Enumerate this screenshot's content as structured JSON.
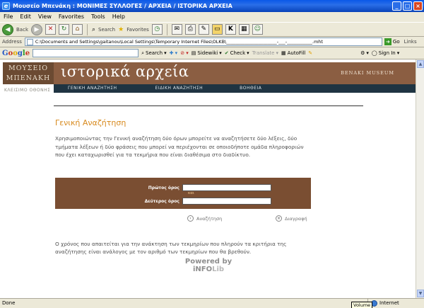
{
  "window": {
    "title": "Μουσείο Μπενάκη : ΜΟΝΙΜΕΣ ΣΥΛΛΟΓΕΣ / ΑΡΧΕΙΑ / ΙΣΤΟΡΙΚΑ ΑΡΧΕΙΑ",
    "minimize": "_",
    "maximize": "□",
    "close": "×"
  },
  "menu": [
    "File",
    "Edit",
    "View",
    "Favorites",
    "Tools",
    "Help"
  ],
  "toolbar": {
    "back": "Back",
    "search": "Search",
    "favorites": "Favorites"
  },
  "address": {
    "label": "Address",
    "url": "C:\\Documents and Settings\\gaitanou\\Local Settings\\Temporary Internet Files\\OLKB\\______________________-___-___________.mht",
    "go": "Go",
    "links": "Links"
  },
  "google": {
    "search": "Search",
    "sidewiki": "Sidewiki",
    "check": "Check",
    "translate": "Translate",
    "autofill": "AutoFill",
    "signin": "Sign In"
  },
  "page": {
    "logo_line1": "ΜΟΥΣΕΙΟ",
    "logo_line2": "ΜΠΕΝΑΚΗ",
    "logo_sub": "ΚΛΕΙΣΙΜΟ ΟΘΟΝΗΣ",
    "header_title": "ιστορικά αρχεία",
    "header_brand": "BENAKI MUSEUM",
    "nav": [
      "ΓΕΝΙΚΗ ΑΝΑΖΗΤΗΣΗ",
      "ΕΙΔΙΚΗ ΑΝΑΖΗΤΗΣΗ",
      "ΒΟΗΘΕΙΑ"
    ],
    "section_title": "Γενική Αναζήτηση",
    "intro": "Χρησιμοποιώντας την Γενική αναζήτηση δύο όρων μπορείτε να αναζητήσετε δύο λέξεις, δύο τμήματα λέξεων ή δύο φράσεις που μπορεί να περιέχονται σε οποιοδήποτε ομάδα πληροφοριών που έχει καταχωρισθεί για τα τεκμήρια που είναι διαθέσιμα στο διαδίκτυο.",
    "first_term_label": "Πρώτος όρος",
    "and_label": "και",
    "second_term_label": "Δεύτερος όρος",
    "first_term_value": "",
    "second_term_value": "",
    "search_action": "Αναζήτηση",
    "clear_action": "Διαγραφή",
    "note": "Ο χρόνος που απαιτείται για την ανάκτηση των τεκμηρίων που πληρούν τα κριτήρια της αναζήτησης είναι ανάλογος με τον αριθμό των τεκμηρίων που θα βρεθούν.",
    "powered_line1": "Powered by",
    "powered_info": "iNFO",
    "powered_lib": "Lib"
  },
  "status": {
    "text": "Done",
    "zone": "Internet",
    "tooltip": "Volume"
  }
}
